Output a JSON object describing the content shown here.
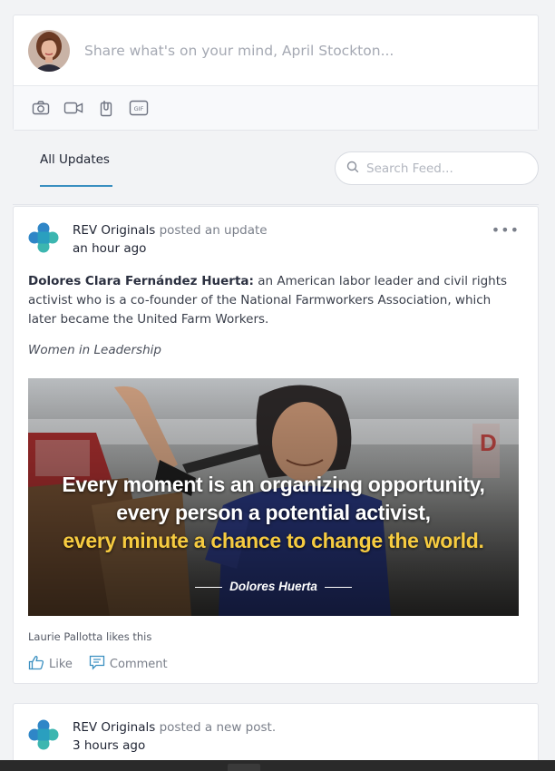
{
  "composer": {
    "placeholder": "Share what's on your mind, April Stockton...",
    "tools": [
      "camera-icon",
      "video-icon",
      "attachment-icon",
      "gif-icon"
    ]
  },
  "feed": {
    "tab_all_updates": "All Updates",
    "search_placeholder": "Search Feed..."
  },
  "posts": [
    {
      "author": "REV Originals",
      "action": "posted an update",
      "time": "an hour ago",
      "body_bold": "Dolores Clara Fernández Huerta:",
      "body": " an American labor leader and civil rights activist who is a co-founder of the National Farmworkers Association, which later became the United Farm Workers.",
      "tagline": "Women in Leadership",
      "image_quote": {
        "line1": "Every moment is an organizing opportunity,",
        "line2": "every person a potential activist,",
        "line3": "every minute a chance to change the world.",
        "attribution": "Dolores Huerta"
      },
      "likes_text": "Laurie Pallotta likes this",
      "like_label": "Like",
      "comment_label": "Comment",
      "more_label": "•••"
    },
    {
      "author": "REV Originals",
      "action": "posted a new post.",
      "time": "3 hours ago"
    }
  ],
  "colors": {
    "accent": "#3a8fc0",
    "quote_highlight": "#f6cb40",
    "brand_blue": "#2f86c7",
    "brand_teal": "#3cb6b0"
  }
}
